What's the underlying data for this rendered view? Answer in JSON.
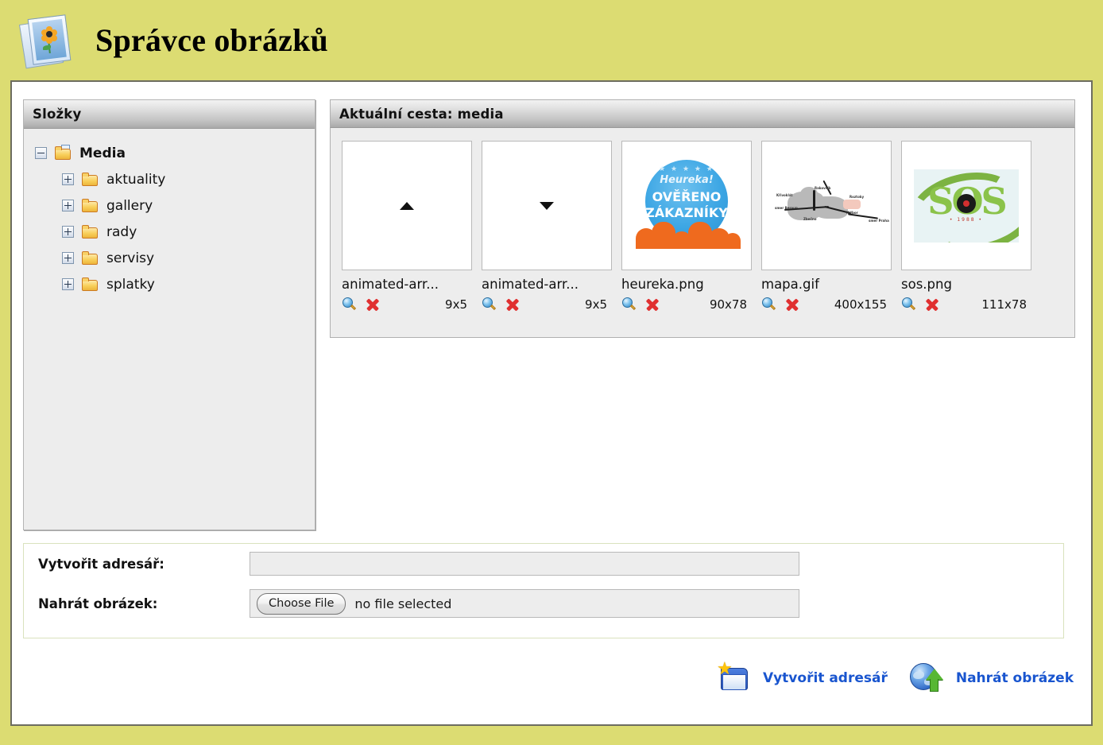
{
  "header": {
    "title": "Správce obrázků",
    "icon": "image-manager-icon",
    "background_color": "#dcdc72"
  },
  "tree_panel": {
    "header": "Složky",
    "nodes": [
      {
        "label": "Media",
        "expander": "minus",
        "icon": "folder-open-icon",
        "level": 0
      },
      {
        "label": "aktuality",
        "expander": "plus",
        "icon": "folder-icon",
        "level": 1
      },
      {
        "label": "gallery",
        "expander": "plus",
        "icon": "folder-icon",
        "level": 1
      },
      {
        "label": "rady",
        "expander": "plus",
        "icon": "folder-icon",
        "level": 1
      },
      {
        "label": "servisy",
        "expander": "plus",
        "icon": "folder-icon",
        "level": 1
      },
      {
        "label": "splatky",
        "expander": "plus",
        "icon": "folder-icon",
        "level": 1
      }
    ]
  },
  "files_panel": {
    "header": "Aktuální cesta: media",
    "files": [
      {
        "name": "animated-arr...",
        "dimensions": "9x5",
        "thumb": "arrow-up",
        "preview_icon": "magnifier-icon",
        "delete_icon": "delete-icon"
      },
      {
        "name": "animated-arr...",
        "dimensions": "9x5",
        "thumb": "arrow-down",
        "preview_icon": "magnifier-icon",
        "delete_icon": "delete-icon"
      },
      {
        "name": "heureka.png",
        "dimensions": "90x78",
        "thumb": "heureka-badge",
        "preview_icon": "magnifier-icon",
        "delete_icon": "delete-icon"
      },
      {
        "name": "mapa.gif",
        "dimensions": "400x155",
        "thumb": "map-image",
        "preview_icon": "magnifier-icon",
        "delete_icon": "delete-icon"
      },
      {
        "name": "sos.png",
        "dimensions": "111x78",
        "thumb": "sos-logo",
        "preview_icon": "magnifier-icon",
        "delete_icon": "delete-icon"
      }
    ],
    "heureka_thumb": {
      "stars": "★ ★ ★ ★ ★",
      "line1": "Heureka!",
      "line2": "OVĚŘENO",
      "line3": "ZÁKAZNÍKY"
    },
    "mapa_thumb": {
      "labels": [
        "Křivoklát",
        "smer Beroun",
        "Rakovník",
        "Zbečno",
        "Roztoky",
        "Nižbor",
        "smer Praha"
      ]
    },
    "sos_thumb": {
      "letters": "SOS",
      "sub": "• 1988 •"
    }
  },
  "form": {
    "create_dir_label": "Vytvořit adresář:",
    "create_dir_value": "",
    "create_dir_placeholder": "",
    "upload_label": "Nahrát obrázek:",
    "choose_file_button": "Choose File",
    "no_file_text": "no file selected"
  },
  "actions": [
    {
      "label": "Vytvořit adresář",
      "icon": "new-folder-icon",
      "color": "#1955cf"
    },
    {
      "label": "Nahrát obrázek",
      "icon": "upload-globe-icon",
      "color": "#1955cf"
    }
  ]
}
